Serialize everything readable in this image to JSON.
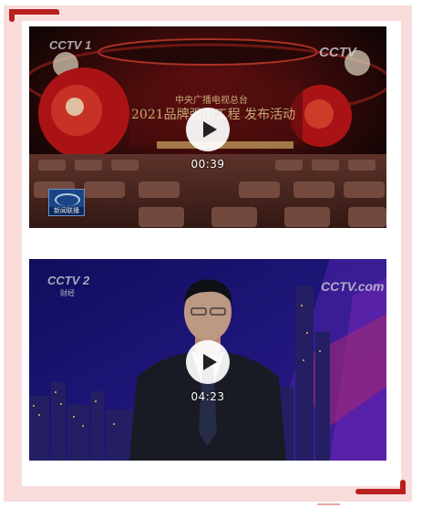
{
  "videos": [
    {
      "duration": "00:39",
      "channel_logo": "CCTV 1",
      "watermark": "CCTV",
      "banner_line1": "中央广播电视总台",
      "banner_line2": "2021品牌强国工程 发布活动",
      "news_badge": "新闻联播"
    },
    {
      "duration": "04:23",
      "channel_logo": "CCTV 2",
      "channel_sub": "财经",
      "watermark": "CCTV.com"
    }
  ],
  "colors": {
    "accent": "#b8201d",
    "frame": "#f8dcdc"
  }
}
